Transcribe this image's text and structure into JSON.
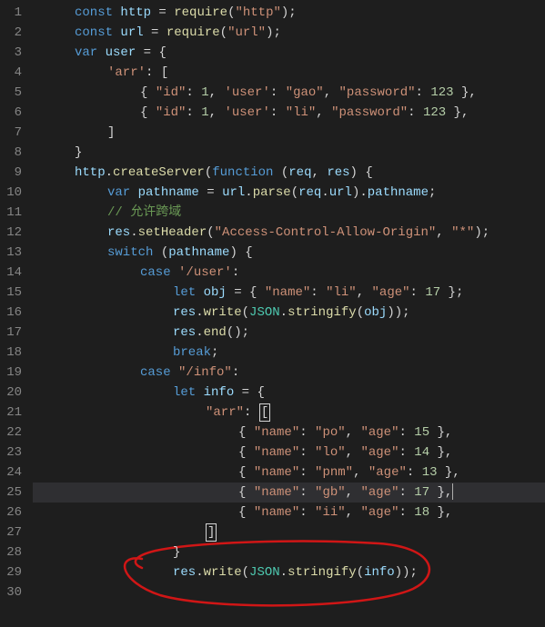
{
  "lines": [
    {
      "n": 1,
      "indent": 2,
      "tokens": [
        [
          "kw",
          "const"
        ],
        [
          "pn",
          " "
        ],
        [
          "var",
          "http"
        ],
        [
          "pn",
          " = "
        ],
        [
          "fn",
          "require"
        ],
        [
          "pn",
          "("
        ],
        [
          "str",
          "\"http\""
        ],
        [
          "pn",
          ");"
        ]
      ]
    },
    {
      "n": 2,
      "indent": 2,
      "tokens": [
        [
          "kw",
          "const"
        ],
        [
          "pn",
          " "
        ],
        [
          "var",
          "url"
        ],
        [
          "pn",
          " = "
        ],
        [
          "fn",
          "require"
        ],
        [
          "pn",
          "("
        ],
        [
          "str",
          "\"url\""
        ],
        [
          "pn",
          ");"
        ]
      ]
    },
    {
      "n": 3,
      "indent": 2,
      "tokens": [
        [
          "kw",
          "var"
        ],
        [
          "pn",
          " "
        ],
        [
          "var",
          "user"
        ],
        [
          "pn",
          " = {"
        ]
      ]
    },
    {
      "n": 4,
      "indent": 4,
      "tokens": [
        [
          "str",
          "'arr'"
        ],
        [
          "pn",
          ": ["
        ]
      ]
    },
    {
      "n": 5,
      "indent": 6,
      "tokens": [
        [
          "pn",
          "{ "
        ],
        [
          "str",
          "\"id\""
        ],
        [
          "pn",
          ": "
        ],
        [
          "num",
          "1"
        ],
        [
          "pn",
          ", "
        ],
        [
          "str",
          "'user'"
        ],
        [
          "pn",
          ": "
        ],
        [
          "str",
          "\"gao\""
        ],
        [
          "pn",
          ", "
        ],
        [
          "str",
          "\"password\""
        ],
        [
          "pn",
          ": "
        ],
        [
          "num",
          "123"
        ],
        [
          "pn",
          " },"
        ]
      ]
    },
    {
      "n": 6,
      "indent": 6,
      "tokens": [
        [
          "pn",
          "{ "
        ],
        [
          "str",
          "\"id\""
        ],
        [
          "pn",
          ": "
        ],
        [
          "num",
          "1"
        ],
        [
          "pn",
          ", "
        ],
        [
          "str",
          "'user'"
        ],
        [
          "pn",
          ": "
        ],
        [
          "str",
          "\"li\""
        ],
        [
          "pn",
          ", "
        ],
        [
          "str",
          "\"password\""
        ],
        [
          "pn",
          ": "
        ],
        [
          "num",
          "123"
        ],
        [
          "pn",
          " },"
        ]
      ]
    },
    {
      "n": 7,
      "indent": 4,
      "tokens": [
        [
          "pn",
          "]"
        ]
      ]
    },
    {
      "n": 8,
      "indent": 2,
      "tokens": [
        [
          "pn",
          "}"
        ]
      ]
    },
    {
      "n": 9,
      "indent": 2,
      "tokens": [
        [
          "var",
          "http"
        ],
        [
          "pn",
          "."
        ],
        [
          "fn",
          "createServer"
        ],
        [
          "pn",
          "("
        ],
        [
          "kw",
          "function"
        ],
        [
          "pn",
          " ("
        ],
        [
          "var",
          "req"
        ],
        [
          "pn",
          ", "
        ],
        [
          "var",
          "res"
        ],
        [
          "pn",
          ") {"
        ]
      ]
    },
    {
      "n": 10,
      "indent": 4,
      "tokens": [
        [
          "kw",
          "var"
        ],
        [
          "pn",
          " "
        ],
        [
          "var",
          "pathname"
        ],
        [
          "pn",
          " = "
        ],
        [
          "var",
          "url"
        ],
        [
          "pn",
          "."
        ],
        [
          "fn",
          "parse"
        ],
        [
          "pn",
          "("
        ],
        [
          "var",
          "req"
        ],
        [
          "pn",
          "."
        ],
        [
          "var",
          "url"
        ],
        [
          "pn",
          ")."
        ],
        [
          "var",
          "pathname"
        ],
        [
          "pn",
          ";"
        ]
      ]
    },
    {
      "n": 11,
      "indent": 4,
      "tokens": [
        [
          "cm",
          "// 允许跨域"
        ]
      ]
    },
    {
      "n": 12,
      "indent": 4,
      "tokens": [
        [
          "var",
          "res"
        ],
        [
          "pn",
          "."
        ],
        [
          "fn",
          "setHeader"
        ],
        [
          "pn",
          "("
        ],
        [
          "str",
          "\"Access-Control-Allow-Origin\""
        ],
        [
          "pn",
          ", "
        ],
        [
          "str",
          "\"*\""
        ],
        [
          "pn",
          ");"
        ]
      ]
    },
    {
      "n": 13,
      "indent": 4,
      "tokens": [
        [
          "kw",
          "switch"
        ],
        [
          "pn",
          " ("
        ],
        [
          "var",
          "pathname"
        ],
        [
          "pn",
          ") {"
        ]
      ]
    },
    {
      "n": 14,
      "indent": 6,
      "tokens": [
        [
          "kw",
          "case"
        ],
        [
          "pn",
          " "
        ],
        [
          "str",
          "'/user'"
        ],
        [
          "pn",
          ":"
        ]
      ]
    },
    {
      "n": 15,
      "indent": 8,
      "tokens": [
        [
          "kw",
          "let"
        ],
        [
          "pn",
          " "
        ],
        [
          "var",
          "obj"
        ],
        [
          "pn",
          " = { "
        ],
        [
          "str",
          "\"name\""
        ],
        [
          "pn",
          ": "
        ],
        [
          "str",
          "\"li\""
        ],
        [
          "pn",
          ", "
        ],
        [
          "str",
          "\"age\""
        ],
        [
          "pn",
          ": "
        ],
        [
          "num",
          "17"
        ],
        [
          "pn",
          " };"
        ]
      ]
    },
    {
      "n": 16,
      "indent": 8,
      "tokens": [
        [
          "var",
          "res"
        ],
        [
          "pn",
          "."
        ],
        [
          "fn",
          "write"
        ],
        [
          "pn",
          "("
        ],
        [
          "obj",
          "JSON"
        ],
        [
          "pn",
          "."
        ],
        [
          "fn",
          "stringify"
        ],
        [
          "pn",
          "("
        ],
        [
          "var",
          "obj"
        ],
        [
          "pn",
          "));"
        ]
      ]
    },
    {
      "n": 17,
      "indent": 8,
      "tokens": [
        [
          "var",
          "res"
        ],
        [
          "pn",
          "."
        ],
        [
          "fn",
          "end"
        ],
        [
          "pn",
          "();"
        ]
      ]
    },
    {
      "n": 18,
      "indent": 8,
      "tokens": [
        [
          "kw",
          "break"
        ],
        [
          "pn",
          ";"
        ]
      ]
    },
    {
      "n": 19,
      "indent": 6,
      "tokens": [
        [
          "kw",
          "case"
        ],
        [
          "pn",
          " "
        ],
        [
          "str",
          "\"/info\""
        ],
        [
          "pn",
          ":"
        ]
      ]
    },
    {
      "n": 20,
      "indent": 8,
      "tokens": [
        [
          "kw",
          "let"
        ],
        [
          "pn",
          " "
        ],
        [
          "var",
          "info"
        ],
        [
          "pn",
          " = {"
        ]
      ]
    },
    {
      "n": 21,
      "indent": 10,
      "tokens": [
        [
          "str",
          "\"arr\""
        ],
        [
          "pn",
          ": "
        ],
        [
          "box",
          "["
        ]
      ]
    },
    {
      "n": 22,
      "indent": 12,
      "tokens": [
        [
          "pn",
          "{ "
        ],
        [
          "str",
          "\"name\""
        ],
        [
          "pn",
          ": "
        ],
        [
          "str",
          "\"po\""
        ],
        [
          "pn",
          ", "
        ],
        [
          "str",
          "\"age\""
        ],
        [
          "pn",
          ": "
        ],
        [
          "num",
          "15"
        ],
        [
          "pn",
          " },"
        ]
      ]
    },
    {
      "n": 23,
      "indent": 12,
      "tokens": [
        [
          "pn",
          "{ "
        ],
        [
          "str",
          "\"name\""
        ],
        [
          "pn",
          ": "
        ],
        [
          "str",
          "\"lo\""
        ],
        [
          "pn",
          ", "
        ],
        [
          "str",
          "\"age\""
        ],
        [
          "pn",
          ": "
        ],
        [
          "num",
          "14"
        ],
        [
          "pn",
          " },"
        ]
      ]
    },
    {
      "n": 24,
      "indent": 12,
      "tokens": [
        [
          "pn",
          "{ "
        ],
        [
          "str",
          "\"name\""
        ],
        [
          "pn",
          ": "
        ],
        [
          "str",
          "\"pnm\""
        ],
        [
          "pn",
          ", "
        ],
        [
          "str",
          "\"age\""
        ],
        [
          "pn",
          ": "
        ],
        [
          "num",
          "13"
        ],
        [
          "pn",
          " },"
        ]
      ]
    },
    {
      "n": 25,
      "indent": 12,
      "hl": true,
      "tokens": [
        [
          "pn",
          "{ "
        ],
        [
          "str",
          "\"name\""
        ],
        [
          "pn",
          ": "
        ],
        [
          "str",
          "\"gb\""
        ],
        [
          "pn",
          ", "
        ],
        [
          "str",
          "\"age\""
        ],
        [
          "pn",
          ": "
        ],
        [
          "num",
          "17"
        ],
        [
          "pn",
          " },"
        ],
        [
          "cursor",
          ""
        ]
      ]
    },
    {
      "n": 26,
      "indent": 12,
      "tokens": [
        [
          "pn",
          "{ "
        ],
        [
          "str",
          "\"name\""
        ],
        [
          "pn",
          ": "
        ],
        [
          "str",
          "\"ii\""
        ],
        [
          "pn",
          ", "
        ],
        [
          "str",
          "\"age\""
        ],
        [
          "pn",
          ": "
        ],
        [
          "num",
          "18"
        ],
        [
          "pn",
          " },"
        ]
      ]
    },
    {
      "n": 27,
      "indent": 10,
      "tokens": [
        [
          "box",
          "]"
        ]
      ]
    },
    {
      "n": 28,
      "indent": 8,
      "tokens": [
        [
          "pn",
          "}"
        ]
      ]
    },
    {
      "n": 29,
      "indent": 8,
      "tokens": [
        [
          "var",
          "res"
        ],
        [
          "pn",
          "."
        ],
        [
          "fn",
          "write"
        ],
        [
          "pn",
          "("
        ],
        [
          "obj",
          "JSON"
        ],
        [
          "pn",
          "."
        ],
        [
          "fn",
          "stringify"
        ],
        [
          "pn",
          "("
        ],
        [
          "var",
          "info"
        ],
        [
          "pn",
          "));"
        ]
      ]
    },
    {
      "n": 30,
      "indent": 0,
      "tokens": []
    }
  ],
  "annotation": {
    "shape": "freehand-circle",
    "color": "#d01616",
    "around_lines": [
      28,
      29
    ]
  }
}
